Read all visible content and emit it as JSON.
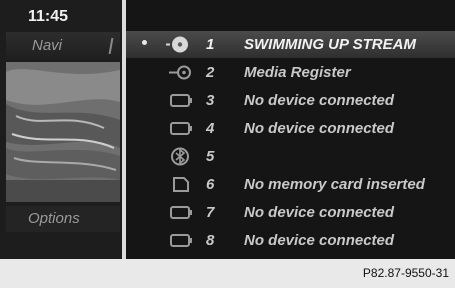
{
  "status_bar": {
    "time": "11:45"
  },
  "sidebar": {
    "title": "Navi",
    "options_label": "Options"
  },
  "media_list": {
    "items": [
      {
        "number": "1",
        "label": "SWIMMING UP STREAM",
        "icon": "disc-icon",
        "selected": true
      },
      {
        "number": "2",
        "label": "Media Register",
        "icon": "hard-drive-icon",
        "selected": false
      },
      {
        "number": "3",
        "label": "No device connected",
        "icon": "usb-device-icon",
        "selected": false
      },
      {
        "number": "4",
        "label": "No device connected",
        "icon": "usb-device-icon",
        "selected": false
      },
      {
        "number": "5",
        "label": "",
        "icon": "bluetooth-audio-icon",
        "selected": false
      },
      {
        "number": "6",
        "label": "No memory card inserted",
        "icon": "memory-card-icon",
        "selected": false
      },
      {
        "number": "7",
        "label": "No device connected",
        "icon": "aux-device-icon",
        "selected": false
      },
      {
        "number": "8",
        "label": "No device connected",
        "icon": "aux-device-icon",
        "selected": false
      }
    ]
  },
  "figure_code": "P82.87-9550-31"
}
